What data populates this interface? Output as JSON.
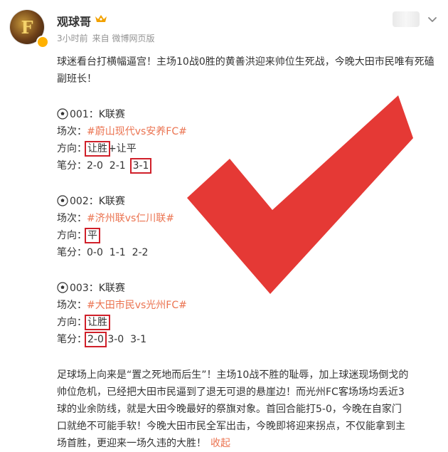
{
  "post": {
    "username": "观球哥",
    "avatar_char": "F",
    "meta": {
      "time": "3小时前",
      "source": "来自 微博网页版"
    },
    "intro": "球迷看台打横幅逼宫！主场10战0胜的黄善洪迎来帅位生死战，今晚大田市民唯有死磕副班长！",
    "matches": [
      {
        "header": "001：K联赛",
        "venue_label": "场次：",
        "venue": "#蔚山现代vs安养FC#",
        "direction_label": "方向：",
        "direction": "让胜",
        "direction_extra": "+让平",
        "score_label": "笔分：",
        "scores": [
          "2-0",
          "2-1",
          "3-1"
        ]
      },
      {
        "header": "002：K联赛",
        "venue_label": "场次：",
        "venue": "#济州联vs仁川联#",
        "direction_label": "方向：",
        "direction": "平",
        "direction_extra": "",
        "score_label": "笔分：",
        "scores": [
          "0-0",
          "1-1",
          "2-2"
        ]
      },
      {
        "header": "003：K联赛",
        "venue_label": "场次：",
        "venue": "#大田市民vs光州FC#",
        "direction_label": "方向：",
        "direction": "让胜",
        "direction_extra": "",
        "score_label": "笔分：",
        "scores": [
          "2-0",
          "3-0",
          "3-1"
        ]
      }
    ],
    "outro_lines": [
      "足球场上向来是“置之死地而后生”！主场10战不胜的耻辱，加上球迷现场倒戈的",
      "帅位危机，已经把大田市民逼到了退无可退的悬崖边！而光州FC客场场均丢近3",
      "球的业余防线，就是大田今晚最好的祭旗对象。首回合能打5-0，今晚在自家门",
      "口就绝不可能手软！今晚大田市民全军出击，今晚即将迎来拐点，不仅能拿到主",
      "场首胜，更迎来一场久违的大胜！"
    ],
    "collapse_label": "收起"
  },
  "colors": {
    "accent_link": "#eb7350",
    "highlight_box": "#d0202a",
    "check_mark": "#e53935",
    "meta_gray": "#939393",
    "text": "#333333"
  },
  "icons": {
    "ball": "soccer-ball-icon",
    "crown": "crown-badge-icon",
    "verified": "verified-badge-icon",
    "chevron": "chevron-down-icon",
    "check": "red-checkmark"
  }
}
